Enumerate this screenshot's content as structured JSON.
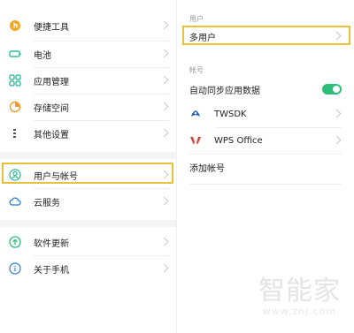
{
  "left_menu": {
    "items": [
      {
        "label": "便捷工具",
        "icon": "hand-tap-icon"
      },
      {
        "label": "电池",
        "icon": "battery-icon"
      },
      {
        "label": "应用管理",
        "icon": "app-grid-icon"
      },
      {
        "label": "存储空间",
        "icon": "storage-pie-icon"
      },
      {
        "label": "其他设置",
        "icon": "more-settings-icon"
      },
      {
        "label": "用户与帐号",
        "icon": "user-account-icon"
      },
      {
        "label": "云服务",
        "icon": "cloud-icon"
      },
      {
        "label": "软件更新",
        "icon": "update-arrow-icon"
      },
      {
        "label": "关于手机",
        "icon": "info-icon"
      }
    ]
  },
  "right_panel": {
    "users_section_header": "用户",
    "multi_user_label": "多用户",
    "accounts_section_header": "帐号",
    "auto_sync_label": "自动同步应用数据",
    "auto_sync_on": true,
    "accounts": [
      {
        "name": "TWSDK",
        "icon": "twsdk-logo-icon"
      },
      {
        "name": "WPS Office",
        "icon": "wps-logo-icon"
      }
    ],
    "add_account_label": "添加帐号"
  },
  "watermark": {
    "title": "智能家",
    "url": "www.znj.com"
  },
  "colors": {
    "highlight": "#e8c13a",
    "toggle_on": "#2bbf7a",
    "cloud_blue": "#2f7bd8",
    "wps_red": "#d93a2b"
  }
}
